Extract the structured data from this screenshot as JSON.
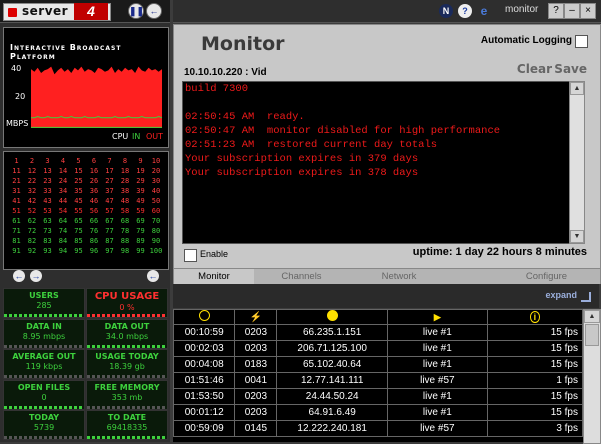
{
  "app": {
    "logo_text": "server",
    "logo_version": "4",
    "window_title": "monitor"
  },
  "icons": {
    "pause": "pause-icon",
    "back": "back-arrow-icon",
    "n_logo": "n-logo-icon",
    "help": "help-icon",
    "ie": "browser-icon"
  },
  "graph": {
    "title": "Interactive Broadcast Platform",
    "y_ticks": [
      "40",
      "20"
    ],
    "y_unit": "MBPS",
    "legend": {
      "cpu": "CPU",
      "in": "IN",
      "out": "OUT"
    }
  },
  "chart_data": {
    "type": "area",
    "title": "Interactive Broadcast Platform",
    "ylabel": "MBPS",
    "ylim": [
      0,
      50
    ],
    "series": [
      {
        "name": "CPU",
        "values": [
          0.5,
          0.5,
          0.5,
          0.5,
          0.5,
          0.5,
          0.5,
          0.5,
          0.5,
          0.5,
          0.5,
          0.5,
          0.5,
          0.5,
          0.5,
          0.5,
          0.5,
          0.5,
          0.5,
          0.5,
          0.5,
          0.5,
          0.5,
          0.5,
          0.5,
          0.5,
          0.5,
          0.5,
          0.5,
          0.5,
          0.5,
          0.5,
          0.5,
          0.5,
          0.5,
          0.5,
          0.5,
          0.5,
          0.5,
          0.5
        ]
      },
      {
        "name": "IN",
        "values": [
          8,
          8,
          9,
          8,
          8,
          9,
          8,
          8,
          8,
          9,
          8,
          8,
          9,
          8,
          8,
          8,
          9,
          8,
          8,
          8,
          9,
          8,
          8,
          8,
          8,
          9,
          8,
          8,
          8,
          9,
          8,
          8,
          8,
          9,
          8,
          8,
          8,
          8,
          9,
          8
        ]
      },
      {
        "name": "OUT",
        "values": [
          46,
          44,
          47,
          43,
          45,
          46,
          48,
          42,
          45,
          47,
          44,
          46,
          43,
          47,
          45,
          48,
          44,
          46,
          45,
          43,
          47,
          46,
          44,
          45,
          48,
          43,
          46,
          44,
          47,
          45,
          46,
          43,
          48,
          45,
          44,
          47,
          45,
          46,
          44,
          46
        ]
      }
    ],
    "colors": {
      "cpu": "#3dd13d",
      "in": "#3dd13d",
      "out": "#ff2020"
    }
  },
  "channel_grid": {
    "rows": [
      [
        "1",
        "2",
        "3",
        "4",
        "5",
        "6",
        "7",
        "8",
        "9",
        "10"
      ],
      [
        "11",
        "12",
        "13",
        "14",
        "15",
        "16",
        "17",
        "18",
        "19",
        "20"
      ],
      [
        "21",
        "22",
        "23",
        "24",
        "25",
        "26",
        "27",
        "28",
        "29",
        "30"
      ],
      [
        "31",
        "32",
        "33",
        "34",
        "35",
        "36",
        "37",
        "38",
        "39",
        "40"
      ],
      [
        "41",
        "42",
        "43",
        "44",
        "45",
        "46",
        "47",
        "48",
        "49",
        "50"
      ],
      [
        "51",
        "52",
        "53",
        "54",
        "55",
        "56",
        "57",
        "58",
        "59",
        "60"
      ],
      [
        "61",
        "62",
        "63",
        "64",
        "65",
        "66",
        "67",
        "68",
        "69",
        "70"
      ],
      [
        "71",
        "72",
        "73",
        "74",
        "75",
        "76",
        "77",
        "78",
        "79",
        "80"
      ],
      [
        "81",
        "82",
        "83",
        "84",
        "85",
        "86",
        "87",
        "88",
        "89",
        "90"
      ],
      [
        "91",
        "92",
        "93",
        "94",
        "95",
        "96",
        "97",
        "98",
        "99",
        "100"
      ]
    ],
    "red_channels": [
      "51",
      "52",
      "53",
      "54",
      "55",
      "56",
      "57",
      "58",
      "59",
      "60"
    ],
    "prev_icon": "arrow-left-icon",
    "next_icon": "arrow-right-icon"
  },
  "stats": [
    {
      "label": "USERS",
      "value": "285",
      "color": "green"
    },
    {
      "label": "CPU USAGE",
      "value": "0 %",
      "color": "red"
    },
    {
      "label": "DATA IN",
      "value": "8.95 mbps",
      "color": "green"
    },
    {
      "label": "DATA OUT",
      "value": "34.0 mbps",
      "color": "green"
    },
    {
      "label": "AVERAGE OUT",
      "value": "119 kbps",
      "color": "green"
    },
    {
      "label": "USAGE TODAY",
      "value": "18.39 gb",
      "color": "green"
    },
    {
      "label": "OPEN FILES",
      "value": "0",
      "color": "green"
    },
    {
      "label": "FREE MEMORY",
      "value": "353 mb",
      "color": "green"
    },
    {
      "label": "TODAY",
      "value": "5739",
      "color": "green"
    },
    {
      "label": "TO DATE",
      "value": "69418335",
      "color": "green"
    }
  ],
  "monitor": {
    "title": "Monitor",
    "auto_logging_label": "Automatic Logging",
    "stream": "10.10.10.220 : Vid",
    "clear_label": "Clear",
    "save_label": "Save",
    "console_lines": [
      "build 7300",
      "",
      "02:50:45 AM  ready.",
      "02:50:47 AM  monitor disabled for high performance",
      "02:51:23 AM  restored current day totals",
      "Your subscription expires in 379 days",
      "Your subscription expires in 378 days"
    ],
    "enable_label": "Enable",
    "uptime": "uptime: 1 day 22 hours 8 minutes",
    "tabs": [
      "Monitor",
      "Channels",
      "Network",
      "Configure"
    ],
    "active_tab": "Monitor",
    "console_color": "#ee1a1a"
  },
  "connections": {
    "expand_label": "expand",
    "header_icons": [
      "clock-icon",
      "bolt-icon",
      "globe-icon",
      "player-icon",
      "info-icon"
    ],
    "rows": [
      [
        "00:10:59",
        "0203",
        "66.235.1.151",
        "live #1",
        "15 fps"
      ],
      [
        "00:02:03",
        "0203",
        "206.71.125.100",
        "live #1",
        "15 fps"
      ],
      [
        "00:04:08",
        "0183",
        "65.102.40.64",
        "live #1",
        "15 fps"
      ],
      [
        "01:51:46",
        "0041",
        "12.77.141.111",
        "live #57",
        "1 fps"
      ],
      [
        "01:53:50",
        "0203",
        "24.44.50.24",
        "live #1",
        "15 fps"
      ],
      [
        "00:01:12",
        "0203",
        "64.91.6.49",
        "live #1",
        "15 fps"
      ],
      [
        "00:59:09",
        "0145",
        "12.222.240.181",
        "live #57",
        "3 fps"
      ]
    ]
  }
}
